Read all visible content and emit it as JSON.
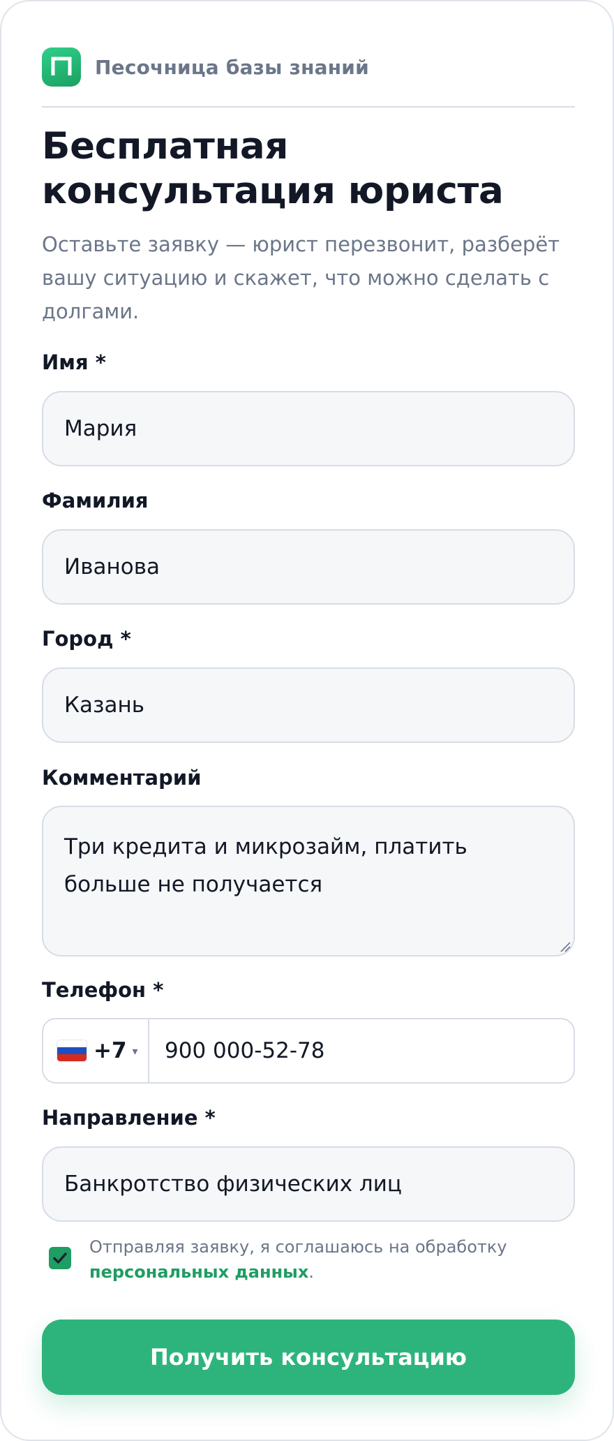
{
  "brand": {
    "logo_icon": "brand-logo-icon",
    "name": "Песочница базы знаний"
  },
  "header": {
    "title": "Бесплатная консультация юриста",
    "subtitle": "Оставьте заявку — юрист перезвонит, разберёт вашу ситуацию и скажет, что можно сделать с долгами."
  },
  "form": {
    "first_name": {
      "label": "Имя *",
      "value": "Мария"
    },
    "last_name": {
      "label": "Фамилия",
      "value": "Иванова"
    },
    "city": {
      "label": "Город *",
      "value": "Казань"
    },
    "comment": {
      "label": "Комментарий",
      "value": "Три кредита и микрозайм, платить больше не получается"
    },
    "phone": {
      "label": "Телефон *",
      "country_flag": "russia-flag-icon",
      "country_code": "+7",
      "caret": "▾",
      "value": "900 000-52-78"
    },
    "direction": {
      "label": "Направление *",
      "value": "Банкротство физических лиц"
    },
    "consent": {
      "checked": true,
      "text": "Отправляя заявку, я соглашаюсь на обработку",
      "link_text": "персональных данных",
      "trailing": "."
    },
    "submit_label": "Получить консультацию"
  },
  "colors": {
    "accent": "#2db47c",
    "accent_dark": "#1f9d63",
    "text_primary": "#121826",
    "text_muted": "#6b7689",
    "field_bg": "#f6f7f9",
    "border": "#d7dce5"
  }
}
